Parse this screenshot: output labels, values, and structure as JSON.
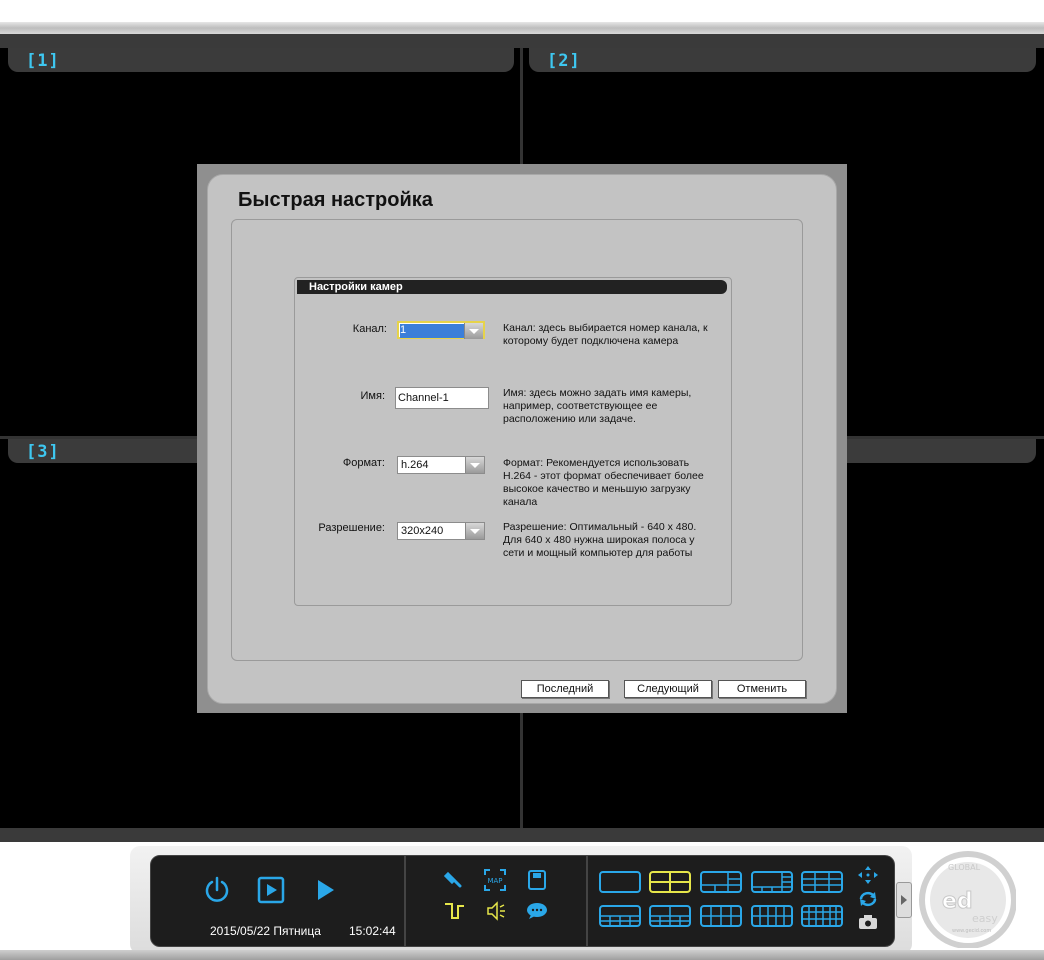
{
  "cameras": [
    {
      "label": "[1]"
    },
    {
      "label": "[2]"
    },
    {
      "label": "[3]"
    }
  ],
  "dialog": {
    "title": "Быстрая настройка",
    "group_title": "Настройки камер",
    "fields": {
      "channel": {
        "label": "Канал:",
        "value": "1",
        "description": "Канал: здесь выбирается номер канала, к которому будет подключена камера"
      },
      "name": {
        "label": "Имя:",
        "value": "Channel-1",
        "description": "Имя: здесь можно задать имя камеры, например, соответствующее ее расположению или задаче."
      },
      "format": {
        "label": "Формат:",
        "value": "h.264",
        "description": "Формат: Рекомендуется использовать H.264 - этот формат обеспечивает более высокое качество и меньшую загрузку канала"
      },
      "resolution": {
        "label": "Разрешение:",
        "value": "320x240",
        "description": "Разрешение: Оптимальный - 640 x 480. Для 640 x 480 нужна широкая полоса у сети и мощный компьютер для работы"
      }
    },
    "buttons": {
      "last": "Последний",
      "next": "Следующий",
      "cancel": "Отменить"
    }
  },
  "toolbar": {
    "date": "2015/05/22 Пятница",
    "time": "15:02:44",
    "map_label": "MAP",
    "icons": [
      "power-icon",
      "playback-icon",
      "play-icon",
      "wrench-icon",
      "map-icon",
      "save-icon",
      "io-pulse-icon",
      "speaker-icon",
      "chat-icon",
      "ptz-arrows-icon",
      "cycle-icon",
      "snapshot-icon"
    ]
  },
  "logo": {
    "top_text": "GLOBAL",
    "bottom_text": "easy",
    "url": "www.gecid.com"
  },
  "colors": {
    "accent_blue": "#2aa7e8",
    "highlight_yellow": "#e6e64a",
    "cam_label": "#3ec7f0"
  }
}
